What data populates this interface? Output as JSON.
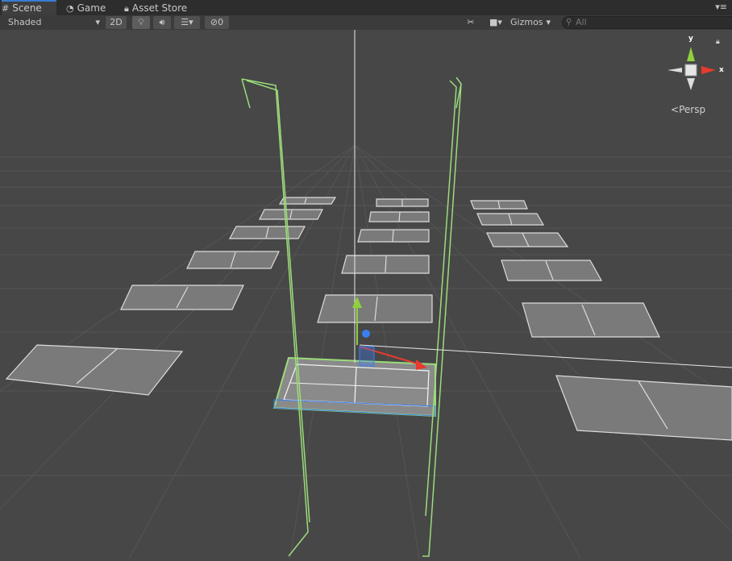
{
  "tabs": [
    {
      "label": "Scene",
      "icon": "grid-icon",
      "active": true
    },
    {
      "label": "Game",
      "icon": "pacman-icon",
      "active": false
    },
    {
      "label": "Asset Store",
      "icon": "lock-icon",
      "active": false
    }
  ],
  "toolbar": {
    "draw_mode": "Shaded",
    "mode_2d": "2D",
    "hidden_count": "0",
    "gizmos_label": "Gizmos",
    "search_placeholder": "All"
  },
  "orientation_gizmo": {
    "x_label": "x",
    "y_label": "y",
    "projection_label": "Persp"
  },
  "colors": {
    "x_axis": "#e63b2e",
    "y_axis": "#8fd13c",
    "z_axis": "#3a7ef0",
    "selection_outline": "#9bdc7a",
    "grid_line": "#5a5a5a",
    "background": "#474747"
  },
  "icons": [
    "grid-icon",
    "pacman-icon",
    "lock-icon",
    "light-icon",
    "audio-icon",
    "effects-icon",
    "hidden-icon",
    "tools-icon",
    "camera-icon",
    "search-icon"
  ]
}
